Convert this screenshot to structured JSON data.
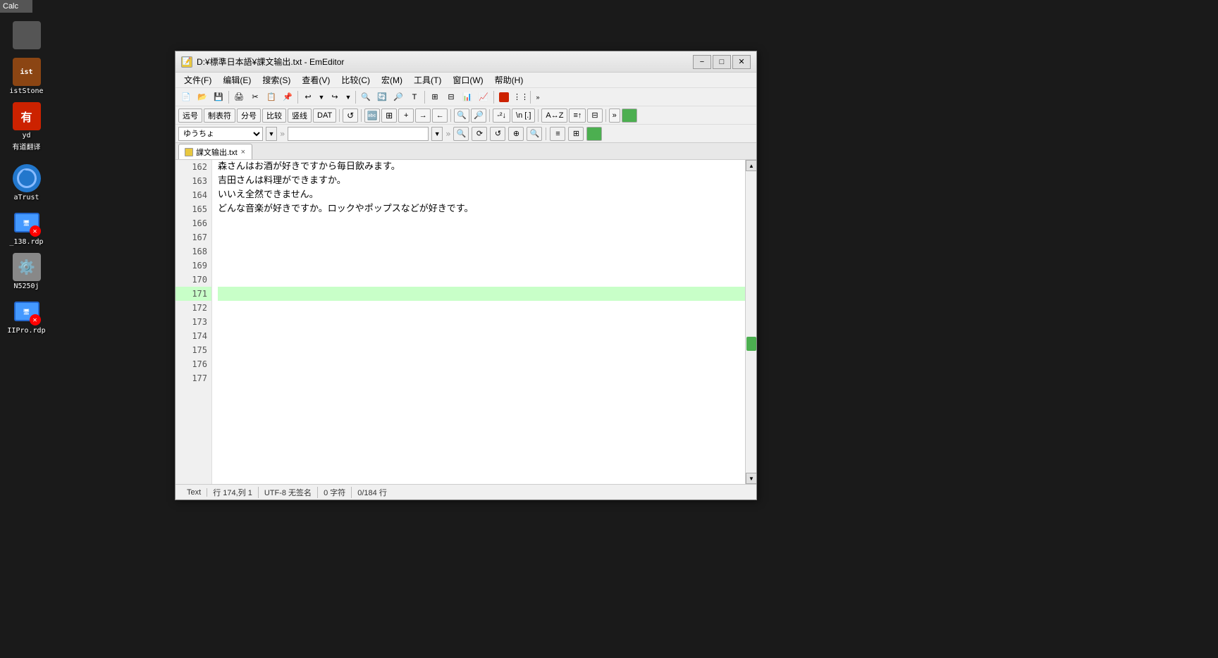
{
  "window": {
    "title": "D:¥標準日本語¥課文输出.txt - EmEditor",
    "minimize_label": "−",
    "maximize_label": "□",
    "close_label": "✕"
  },
  "taskbar": {
    "calc_label": "Calc"
  },
  "menu": {
    "items": [
      {
        "label": "文件(F)"
      },
      {
        "label": "编辑(E)"
      },
      {
        "label": "搜索(S)"
      },
      {
        "label": "查看(V)"
      },
      {
        "label": "比较(C)"
      },
      {
        "label": "宏(M)"
      },
      {
        "label": "工具(T)"
      },
      {
        "label": "窗口(W)"
      },
      {
        "label": "帮助(H)"
      }
    ]
  },
  "toolbar2": {
    "items": [
      {
        "label": "远号"
      },
      {
        "label": "制表符"
      },
      {
        "label": "分号"
      },
      {
        "label": "比较"
      },
      {
        "label": "竖线"
      },
      {
        "label": "DAT"
      }
    ]
  },
  "address_bar": {
    "combo_value": "ゆうちょ",
    "input_placeholder": ""
  },
  "tab": {
    "label": "課文输出.txt",
    "close_label": "×"
  },
  "editor": {
    "lines": [
      {
        "number": 162,
        "text": "森さんはお酒が好きですから毎日飲みます。",
        "highlighted": false
      },
      {
        "number": 163,
        "text": "    吉田さんは料理ができますか。",
        "highlighted": false
      },
      {
        "number": 164,
        "text": "    いいえ全然できません。",
        "highlighted": false
      },
      {
        "number": 165,
        "text": "どんな音楽が好きですか。ロックやポップスなどが好きです。",
        "highlighted": false
      },
      {
        "number": 166,
        "text": "",
        "highlighted": false
      },
      {
        "number": 167,
        "text": "",
        "highlighted": false
      },
      {
        "number": 168,
        "text": "",
        "highlighted": false
      },
      {
        "number": 169,
        "text": "",
        "highlighted": false
      },
      {
        "number": 170,
        "text": "",
        "highlighted": false
      },
      {
        "number": 171,
        "text": "",
        "highlighted": true
      },
      {
        "number": 172,
        "text": "",
        "highlighted": false
      },
      {
        "number": 173,
        "text": "",
        "highlighted": false
      },
      {
        "number": 174,
        "text": "",
        "highlighted": false
      },
      {
        "number": 175,
        "text": "",
        "highlighted": false
      },
      {
        "number": 176,
        "text": "",
        "highlighted": false
      },
      {
        "number": 177,
        "text": "",
        "highlighted": false
      }
    ]
  },
  "status_bar": {
    "mode": "Text",
    "position": "行 174,列 1",
    "encoding": "UTF-8 无签名",
    "chars": "0 字符",
    "lines_info": "0/184 行"
  },
  "desktop_icons": [
    {
      "label": "Calc",
      "color": "#555",
      "icon": "🧮"
    },
    {
      "label": "istStone",
      "color": "#666",
      "icon": "🪨"
    },
    {
      "label": "yd",
      "color": "#e00",
      "icon": "📖"
    },
    {
      "label": "有道翻译",
      "color": "#e00",
      "icon": ""
    },
    {
      "label": "aTrust",
      "color": "#2277cc",
      "icon": "🌐"
    },
    {
      "label": "_138.rdp",
      "color": "#4499ff",
      "icon": "🖥️"
    },
    {
      "label": "N5250j",
      "color": "#888",
      "icon": "⚙️"
    },
    {
      "label": "IIPro.rdp",
      "color": "#4499ff",
      "icon": "🖥️"
    }
  ]
}
